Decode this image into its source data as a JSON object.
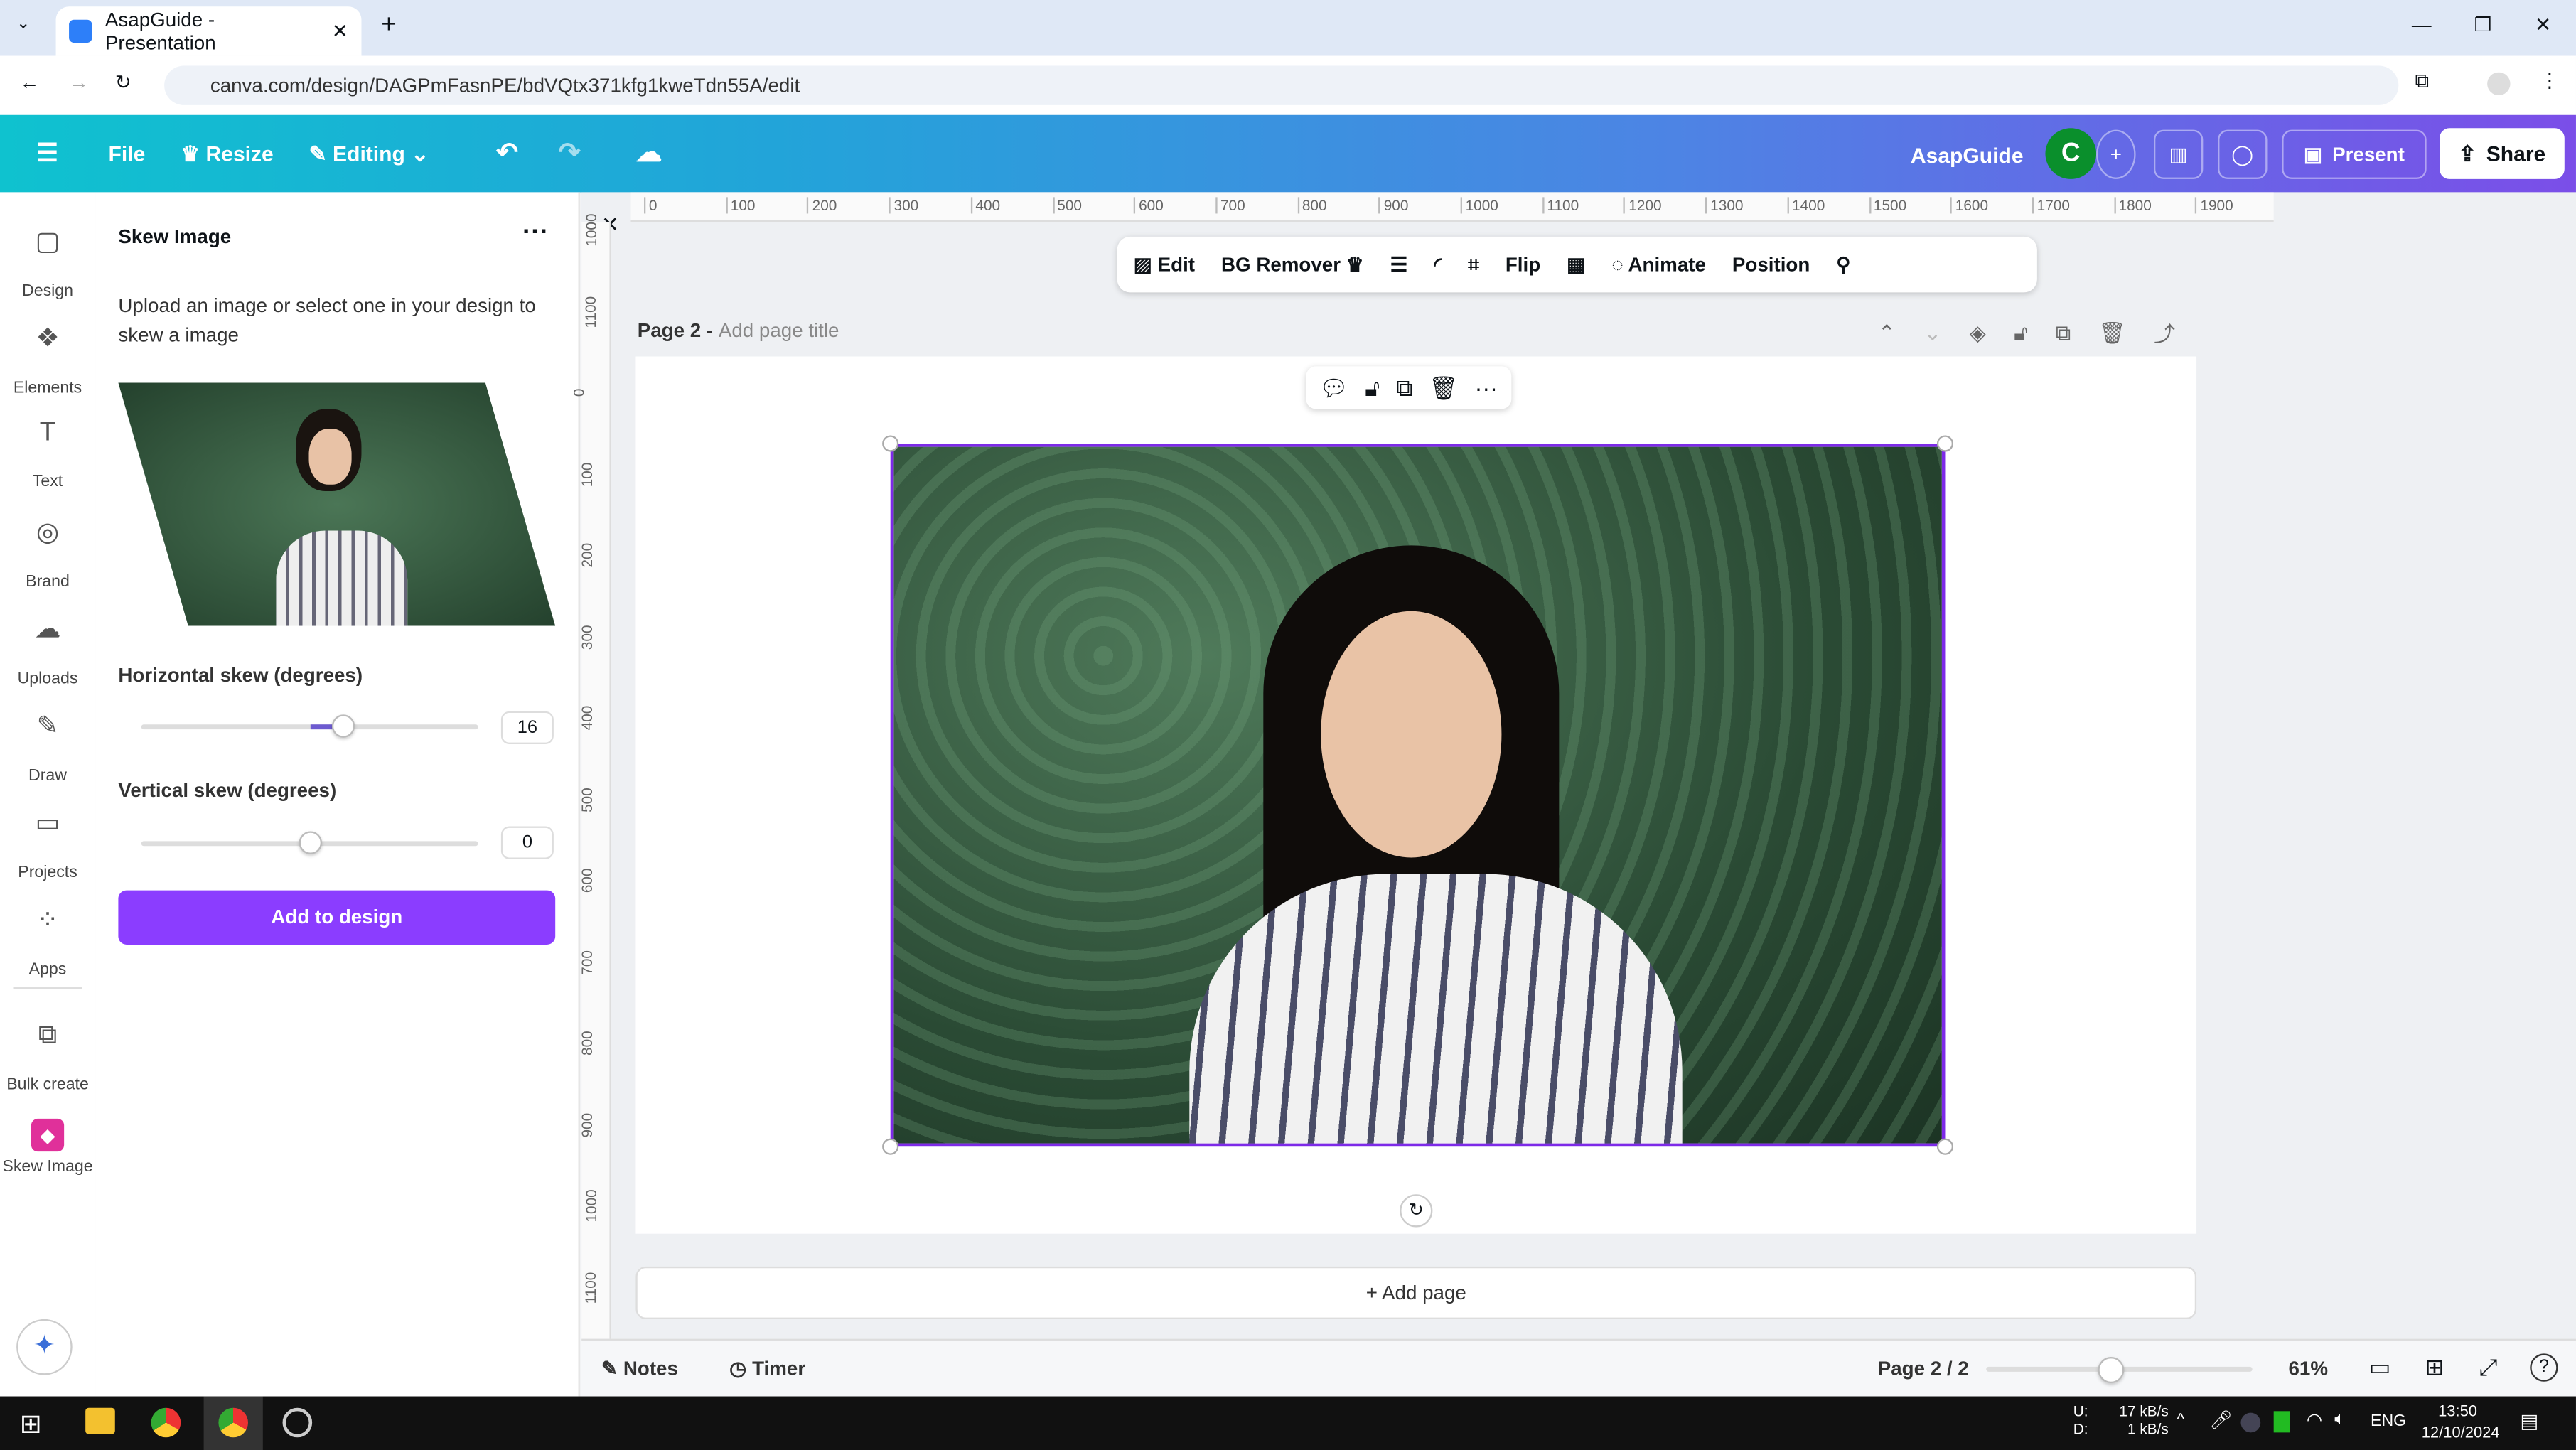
{
  "browser": {
    "tab_title": "AsapGuide - Presentation",
    "url": "canva.com/design/DAGPmFasnPE/bdVQtx371kfg1kweTdn55A/edit"
  },
  "topbar": {
    "file": "File",
    "resize": "Resize",
    "editing": "Editing",
    "team": "AsapGuide",
    "avatar": "C",
    "present": "Present",
    "share": "Share"
  },
  "rail": [
    {
      "label": "Design",
      "icon": "▢"
    },
    {
      "label": "Elements",
      "icon": "❖"
    },
    {
      "label": "Text",
      "icon": "T"
    },
    {
      "label": "Brand",
      "icon": "◎"
    },
    {
      "label": "Uploads",
      "icon": "☁"
    },
    {
      "label": "Draw",
      "icon": "✎"
    },
    {
      "label": "Projects",
      "icon": "▭"
    },
    {
      "label": "Apps",
      "icon": "⁘"
    },
    {
      "label": "Bulk create",
      "icon": "⧉"
    },
    {
      "label": "Skew Image",
      "icon": "◆"
    }
  ],
  "panel": {
    "title": "Skew Image",
    "description": "Upload an image or select one in your design to skew a image",
    "hskew_label": "Horizontal skew (degrees)",
    "hskew_value": "16",
    "hskew_fraction": 0.6,
    "vskew_label": "Vertical skew (degrees)",
    "vskew_value": "0",
    "vskew_fraction": 0.5,
    "add_button": "Add to design"
  },
  "ruler": {
    "h": [
      "0",
      "100",
      "200",
      "300",
      "400",
      "500",
      "600",
      "700",
      "800",
      "900",
      "1000",
      "1100",
      "1200",
      "1300",
      "1400",
      "1500",
      "1600",
      "1700",
      "1800",
      "1900"
    ],
    "v": [
      "1000",
      "1100",
      "0",
      "100",
      "200",
      "300",
      "400",
      "500",
      "600",
      "700",
      "800",
      "900",
      "1000",
      "1100"
    ]
  },
  "context_toolbar": {
    "edit": "Edit",
    "bg_remover": "BG Remover",
    "flip": "Flip",
    "animate": "Animate",
    "position": "Position"
  },
  "page": {
    "label": "Page 2 -",
    "title_placeholder": "Add page title",
    "add_page": "+ Add page"
  },
  "bottom": {
    "notes": "Notes",
    "timer": "Timer",
    "page_indicator": "Page 2 / 2",
    "zoom": "61%",
    "zoom_fraction": 0.46
  },
  "taskbar": {
    "up": "U:",
    "down": "D:",
    "up_speed": "17 kB/s",
    "down_speed": "1 kB/s",
    "lang": "ENG",
    "time": "13:50",
    "date": "12/10/2024"
  }
}
